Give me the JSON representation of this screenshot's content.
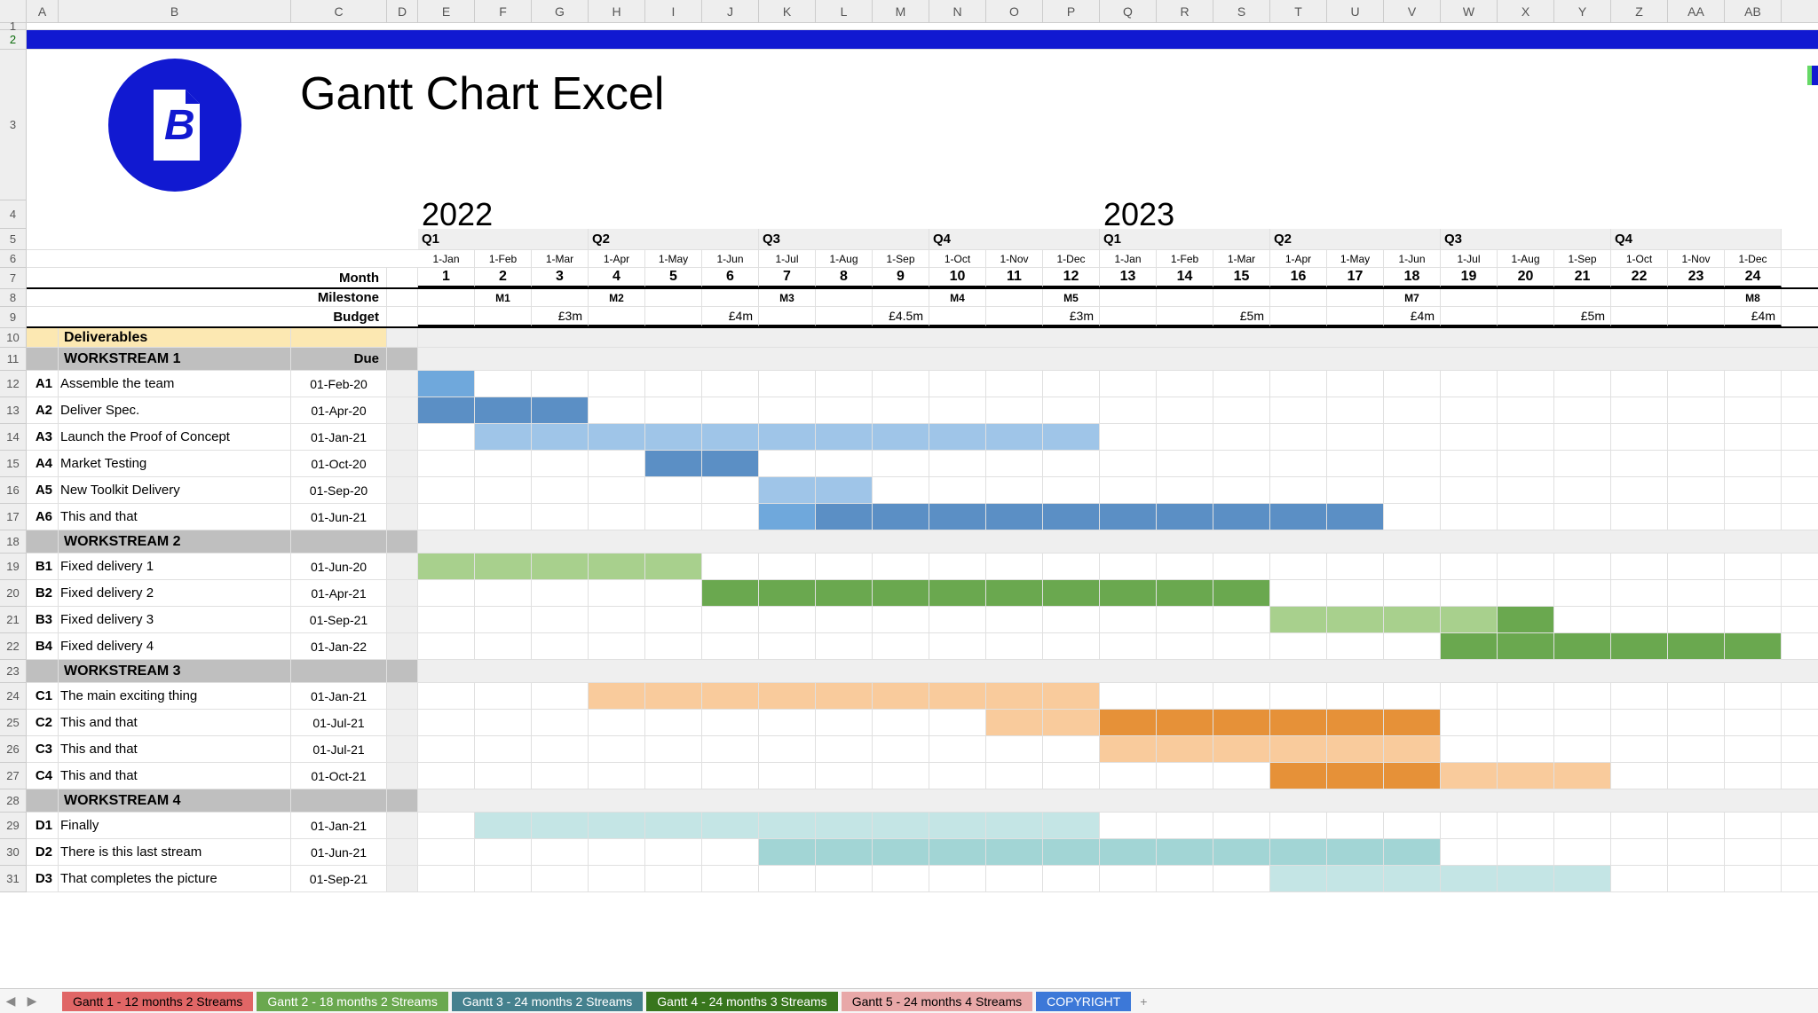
{
  "columns": [
    "A",
    "B",
    "C",
    "D",
    "E",
    "F",
    "G",
    "H",
    "I",
    "J",
    "K",
    "L",
    "M",
    "N",
    "O",
    "P",
    "Q",
    "R",
    "S",
    "T",
    "U",
    "V",
    "W",
    "X",
    "Y",
    "Z",
    "AA",
    "AB"
  ],
  "rowNumbers": [
    "1",
    "2",
    "3",
    "4",
    "5",
    "6",
    "7",
    "8",
    "9",
    "10",
    "11",
    "12",
    "13",
    "14",
    "15",
    "16",
    "17",
    "18",
    "19",
    "20",
    "21",
    "22",
    "23",
    "24",
    "25",
    "26",
    "27",
    "28",
    "29",
    "30",
    "31"
  ],
  "title": "Gantt Chart Excel",
  "years": {
    "y1": "2022",
    "y2": "2023"
  },
  "labels": {
    "month": "Month",
    "milestone": "Milestone",
    "budget": "Budget",
    "deliverables": "Deliverables",
    "due": "Due"
  },
  "quarters": [
    "Q1",
    "Q2",
    "Q3",
    "Q4",
    "Q1",
    "Q2",
    "Q3",
    "Q4"
  ],
  "months": [
    "1-Jan",
    "1-Feb",
    "1-Mar",
    "1-Apr",
    "1-May",
    "1-Jun",
    "1-Jul",
    "1-Aug",
    "1-Sep",
    "1-Oct",
    "1-Nov",
    "1-Dec",
    "1-Jan",
    "1-Feb",
    "1-Mar",
    "1-Apr",
    "1-May",
    "1-Jun",
    "1-Jul",
    "1-Aug",
    "1-Sep",
    "1-Oct",
    "1-Nov",
    "1-Dec"
  ],
  "monthNums": [
    "1",
    "2",
    "3",
    "4",
    "5",
    "6",
    "7",
    "8",
    "9",
    "10",
    "11",
    "12",
    "13",
    "14",
    "15",
    "16",
    "17",
    "18",
    "19",
    "20",
    "21",
    "22",
    "23",
    "24"
  ],
  "milestones": [
    "",
    "M1",
    "",
    "M2",
    "",
    "",
    "M3",
    "",
    "",
    "M4",
    "",
    "M5",
    "",
    "",
    "",
    "",
    "",
    "M7",
    "",
    "",
    "",
    "",
    "",
    "M8"
  ],
  "budgets": [
    "",
    "",
    "£3m",
    "",
    "",
    "£4m",
    "",
    "",
    "£4.5m",
    "",
    "",
    "£3m",
    "",
    "",
    "£5m",
    "",
    "",
    "£4m",
    "",
    "",
    "£5m",
    "",
    "",
    "£4m"
  ],
  "workstreams": {
    "ws1": "WORKSTREAM 1",
    "ws2": "WORKSTREAM 2",
    "ws3": "WORKSTREAM 3",
    "ws4": "WORKSTREAM 4"
  },
  "tasks": {
    "a1": {
      "id": "A1",
      "name": "Assemble the team",
      "due": "01-Feb-20"
    },
    "a2": {
      "id": "A2",
      "name": "Deliver Spec.",
      "due": "01-Apr-20"
    },
    "a3": {
      "id": "A3",
      "name": "Launch the Proof of Concept",
      "due": "01-Jan-21"
    },
    "a4": {
      "id": "A4",
      "name": "Market Testing",
      "due": "01-Oct-20"
    },
    "a5": {
      "id": "A5",
      "name": "New Toolkit Delivery",
      "due": "01-Sep-20"
    },
    "a6": {
      "id": "A6",
      "name": "This and that",
      "due": "01-Jun-21"
    },
    "b1": {
      "id": "B1",
      "name": "Fixed delivery 1",
      "due": "01-Jun-20"
    },
    "b2": {
      "id": "B2",
      "name": "Fixed delivery 2",
      "due": "01-Apr-21"
    },
    "b3": {
      "id": "B3",
      "name": "Fixed delivery 3",
      "due": "01-Sep-21"
    },
    "b4": {
      "id": "B4",
      "name": "Fixed delivery 4",
      "due": "01-Jan-22"
    },
    "c1": {
      "id": "C1",
      "name": "The main exciting thing",
      "due": "01-Jan-21"
    },
    "c2": {
      "id": "C2",
      "name": "This and that",
      "due": "01-Jul-21"
    },
    "c3": {
      "id": "C3",
      "name": "This and that",
      "due": "01-Jul-21"
    },
    "c4": {
      "id": "C4",
      "name": "This and that",
      "due": "01-Oct-21"
    },
    "d1": {
      "id": "D1",
      "name": "Finally",
      "due": "01-Jan-21"
    },
    "d2": {
      "id": "D2",
      "name": "There is this last stream",
      "due": "01-Jun-21"
    },
    "d3": {
      "id": "D3",
      "name": "That completes the picture",
      "due": "01-Sep-21"
    }
  },
  "sheetTabs": {
    "t1": "Gantt 1 - 12 months  2 Streams",
    "t2": "Gantt 2 - 18 months 2 Streams",
    "t3": "Gantt 3 - 24 months 2 Streams",
    "t4": "Gantt 4 - 24 months 3 Streams",
    "t5": "Gantt 5 - 24 months 4 Streams",
    "t6": "COPYRIGHT"
  },
  "chart_data": {
    "type": "table",
    "title": "Gantt Chart Excel",
    "timeline_months": 24,
    "bars": [
      {
        "task": "A1",
        "start": 1,
        "end": 1,
        "color": "blue-med"
      },
      {
        "task": "A2",
        "start": 1,
        "end": 3,
        "color": "blue-dark"
      },
      {
        "task": "A3",
        "start": 2,
        "end": 12,
        "color": "blue-light"
      },
      {
        "task": "A4",
        "start": 5,
        "end": 6,
        "color": "blue-dark"
      },
      {
        "task": "A5",
        "start": 7,
        "end": 8,
        "color": "blue-light"
      },
      {
        "task": "A6",
        "start": 7,
        "end": 17,
        "color": "blue-dark"
      },
      {
        "task": "B1",
        "start": 1,
        "end": 5,
        "color": "green-light"
      },
      {
        "task": "B2",
        "start": 6,
        "end": 15,
        "color": "green-dark"
      },
      {
        "task": "B3",
        "start": 16,
        "end": 20,
        "color": "green-light"
      },
      {
        "task": "B4",
        "start": 19,
        "end": 24,
        "color": "green-dark"
      },
      {
        "task": "C1",
        "start": 4,
        "end": 12,
        "color": "orange-light"
      },
      {
        "task": "C2",
        "start": 11,
        "end": 18,
        "color": "orange-light/dark"
      },
      {
        "task": "C3",
        "start": 13,
        "end": 18,
        "color": "orange-light"
      },
      {
        "task": "C4",
        "start": 16,
        "end": 21,
        "color": "orange-light/dark"
      },
      {
        "task": "D1",
        "start": 2,
        "end": 12,
        "color": "teal-light"
      },
      {
        "task": "D2",
        "start": 7,
        "end": 18,
        "color": "teal-med"
      },
      {
        "task": "D3",
        "start": 16,
        "end": 21,
        "color": "teal-light"
      }
    ]
  }
}
